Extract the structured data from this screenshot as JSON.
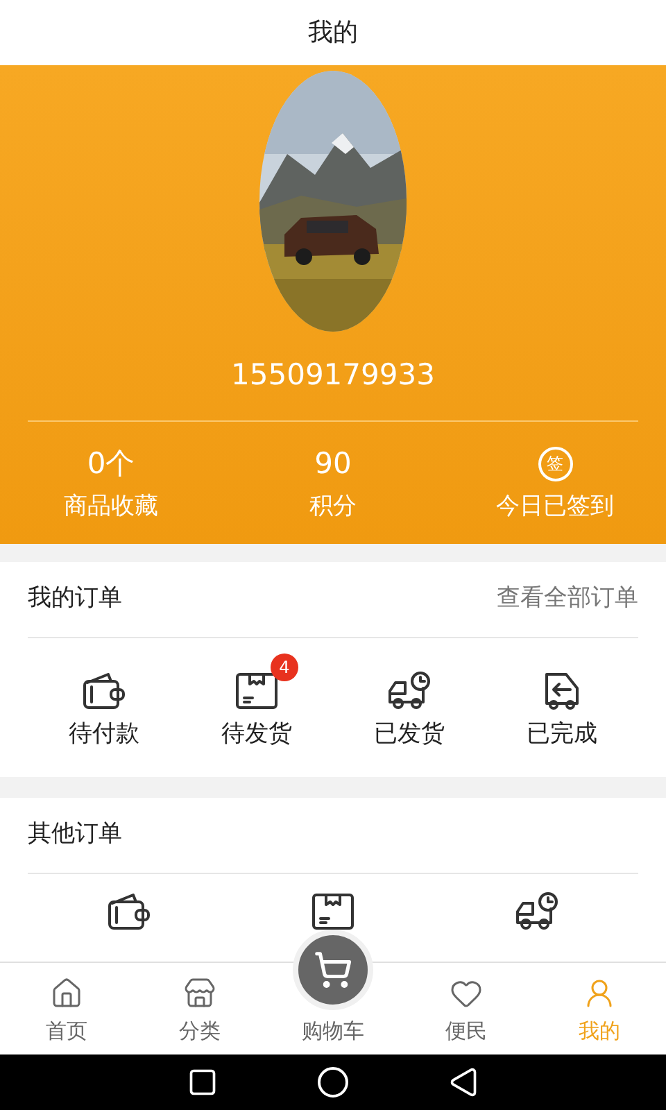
{
  "header": {
    "title": "我的"
  },
  "profile": {
    "phone": "15509179933"
  },
  "stats": [
    {
      "kind": "value",
      "value": "0个",
      "label": "商品收藏"
    },
    {
      "kind": "value",
      "value": "90",
      "label": "积分"
    },
    {
      "kind": "seal",
      "value": "签",
      "label": "今日已签到"
    }
  ],
  "my_orders": {
    "title": "我的订单",
    "link": "查看全部订单",
    "items": [
      {
        "kind": "wallet",
        "label": "待付款"
      },
      {
        "kind": "box",
        "label": "待发货",
        "badge": "4"
      },
      {
        "kind": "truck",
        "label": "已发货"
      },
      {
        "kind": "return",
        "label": "已完成"
      }
    ]
  },
  "other_orders": {
    "title": "其他订单",
    "items": [
      {
        "kind": "wallet"
      },
      {
        "kind": "box"
      },
      {
        "kind": "truck"
      }
    ]
  },
  "tab_bar": {
    "items": [
      {
        "kind": "home",
        "label": "首页",
        "selected": false
      },
      {
        "kind": "shop",
        "label": "分类",
        "selected": false
      },
      {
        "kind": "cart",
        "label": "购物车",
        "selected": false
      },
      {
        "kind": "heart",
        "label": "便民",
        "selected": false
      },
      {
        "kind": "user",
        "label": "我的",
        "selected": true
      }
    ]
  }
}
